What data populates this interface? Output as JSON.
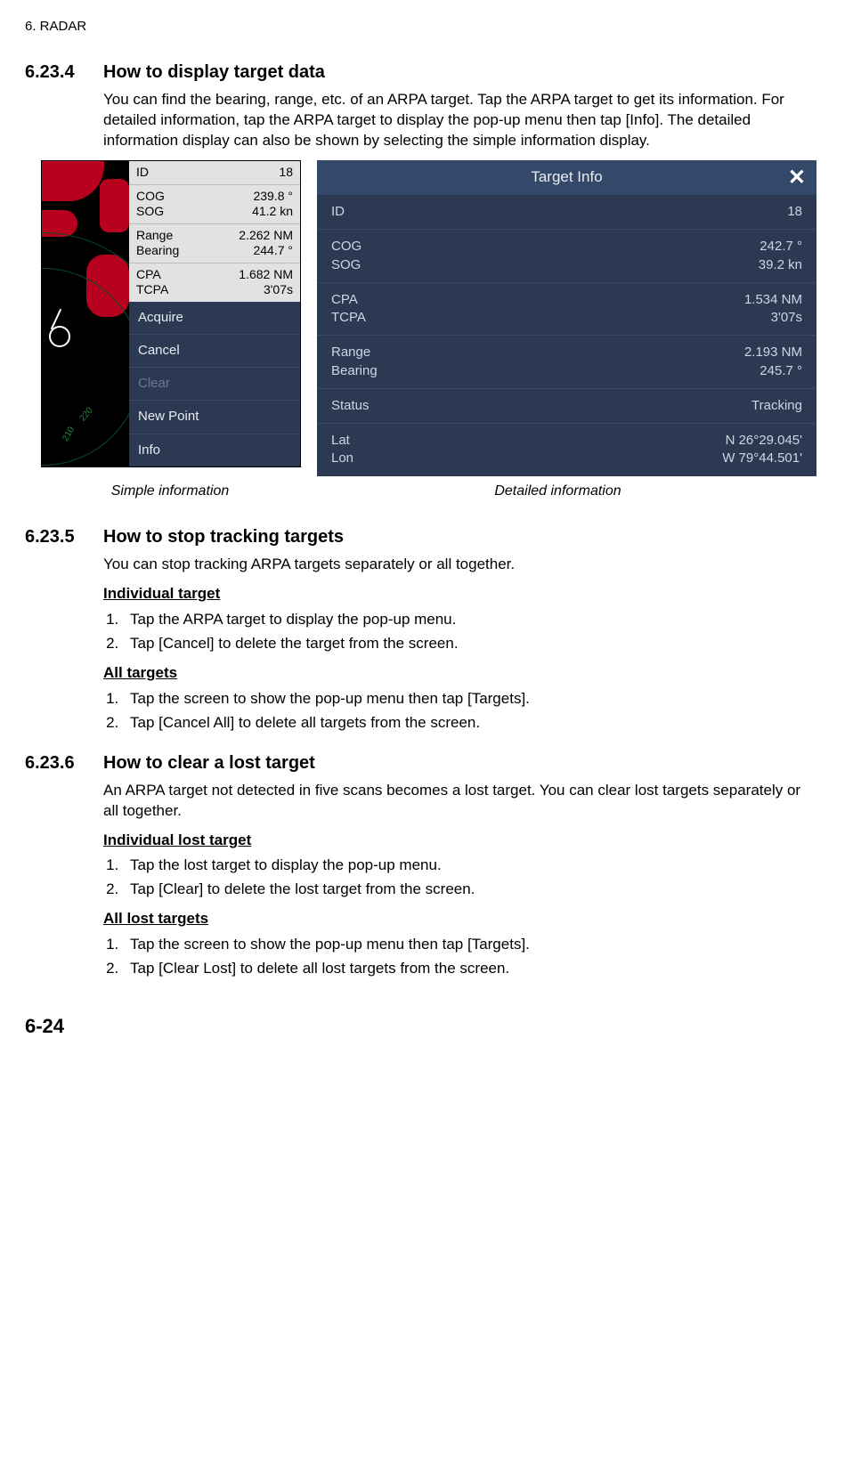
{
  "header": "6.  RADAR",
  "s1": {
    "num": "6.23.4",
    "title": "How to display target data",
    "body": "You can find the bearing, range, etc. of an ARPA target. Tap the ARPA target to get its information. For detailed information, tap the ARPA target to display the pop-up menu then tap [Info]. The detailed information display can also be shown by selecting the simple information display."
  },
  "simple": {
    "id_l": "ID",
    "id_v": "18",
    "cog_l": "COG",
    "cog_v": "239.8 °",
    "sog_l": "SOG",
    "sog_v": "41.2 kn",
    "range_l": "Range",
    "range_v": "2.262 NM",
    "bearing_l": "Bearing",
    "bearing_v": "244.7 °",
    "cpa_l": "CPA",
    "cpa_v": "1.682 NM",
    "tcpa_l": "TCPA",
    "tcpa_v": "3'07s"
  },
  "popup": {
    "acquire": "Acquire",
    "cancel": "Cancel",
    "clear": "Clear",
    "newpoint": "New Point",
    "info": "Info"
  },
  "detail": {
    "title": "Target Info",
    "id_l": "ID",
    "id_v": "18",
    "cog_l": "COG",
    "cog_v": "242.7 °",
    "sog_l": "SOG",
    "sog_v": "39.2 kn",
    "cpa_l": "CPA",
    "cpa_v": "1.534 NM",
    "tcpa_l": "TCPA",
    "tcpa_v": "3'07s",
    "range_l": "Range",
    "range_v": "2.193 NM",
    "bearing_l": "Bearing",
    "bearing_v": "245.7 °",
    "status_l": "Status",
    "status_v": "Tracking",
    "lat_l": "Lat",
    "lat_v": "N 26°29.045'",
    "lon_l": "Lon",
    "lon_v": "W 79°44.501'"
  },
  "caption_simple": "Simple information",
  "caption_detail": "Detailed information",
  "s2": {
    "num": "6.23.5",
    "title": "How to stop tracking targets",
    "body": "You can stop tracking ARPA targets separately or all together.",
    "sub1": "Individual target",
    "sub1_step1": "Tap the ARPA target to display the pop-up menu.",
    "sub1_step2": "Tap [Cancel] to delete the target from the screen.",
    "sub2": "All targets",
    "sub2_step1": "Tap the screen to show the pop-up menu then tap [Targets].",
    "sub2_step2": "Tap [Cancel All] to delete all targets from the screen."
  },
  "s3": {
    "num": "6.23.6",
    "title": "How to clear a lost target",
    "body": "An ARPA target not detected in five scans becomes a lost target. You can clear lost targets separately or all together.",
    "sub1": "Individual lost target",
    "sub1_step1": "Tap the lost target to display the pop-up menu.",
    "sub1_step2": "Tap [Clear] to delete the lost target from the screen.",
    "sub2": "All lost targets",
    "sub2_step1": "Tap the screen to show the pop-up menu then tap [Targets].",
    "sub2_step2": "Tap [Clear Lost] to delete all lost targets from the screen."
  },
  "pagenum": "6-24"
}
